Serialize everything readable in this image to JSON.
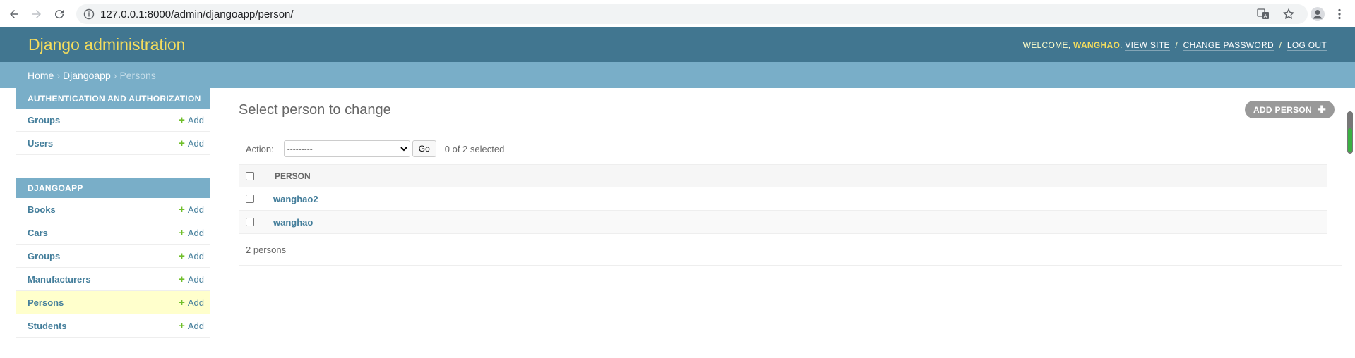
{
  "browser": {
    "url": "127.0.0.1:8000/admin/djangoapp/person/"
  },
  "header": {
    "brand": "Django administration",
    "welcome": "WELCOME,",
    "username": "WANGHAO",
    "view_site": "VIEW SITE",
    "change_password": "CHANGE PASSWORD",
    "log_out": "LOG OUT",
    "sep": "/"
  },
  "breadcrumbs": {
    "home": "Home",
    "app": "Djangoapp",
    "current": "Persons",
    "sep": "›"
  },
  "sidebar": {
    "auth": {
      "caption": "AUTHENTICATION AND AUTHORIZATION",
      "items": [
        {
          "name": "Groups",
          "add": "Add"
        },
        {
          "name": "Users",
          "add": "Add"
        }
      ]
    },
    "app": {
      "caption": "DJANGOAPP",
      "items": [
        {
          "name": "Books",
          "add": "Add"
        },
        {
          "name": "Cars",
          "add": "Add"
        },
        {
          "name": "Groups",
          "add": "Add"
        },
        {
          "name": "Manufacturers",
          "add": "Add"
        },
        {
          "name": "Persons",
          "add": "Add"
        },
        {
          "name": "Students",
          "add": "Add"
        }
      ]
    }
  },
  "main": {
    "title": "Select person to change",
    "add_button": "ADD PERSON",
    "action_label": "Action:",
    "action_selected": "---------",
    "go_label": "Go",
    "selected_counter": "0 of 2 selected",
    "column_header": "PERSON",
    "rows": [
      "wanghao2",
      "wanghao"
    ],
    "paginator": "2 persons"
  },
  "colors": {
    "header_bg": "#417690",
    "breadcrumb_bg": "#79aec8",
    "brand_yellow": "#f5dd5d",
    "link_blue": "#447e9b",
    "add_green": "#70bf2b",
    "current_row_bg": "#ffffcc"
  }
}
